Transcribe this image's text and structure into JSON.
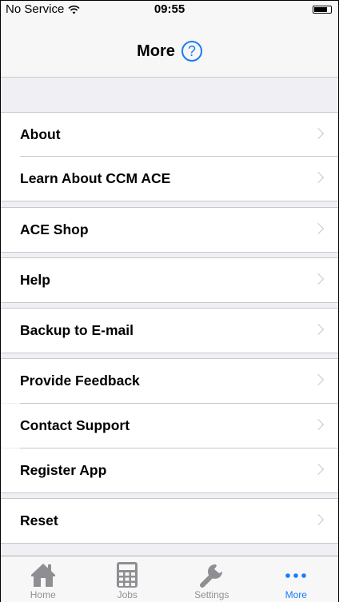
{
  "status_bar": {
    "carrier": "No Service",
    "time": "09:55",
    "battery_level": 0.8
  },
  "nav": {
    "title": "More",
    "help_symbol": "?"
  },
  "menu": {
    "about": "About",
    "learn": "Learn About CCM ACE",
    "shop": "ACE Shop",
    "help": "Help",
    "backup": "Backup to E-mail",
    "feedback": "Provide Feedback",
    "contact": "Contact Support",
    "register": "Register App",
    "reset": "Reset"
  },
  "tabs": {
    "home": "Home",
    "jobs": "Jobs",
    "settings": "Settings",
    "more": "More",
    "active": "more"
  },
  "colors": {
    "accent": "#1b7cf5",
    "inactive": "#929292",
    "group_background": "#efeff4",
    "separator": "#c8c7cc"
  },
  "icons": {
    "wifi": "wifi-icon",
    "battery": "battery-icon",
    "help": "help-icon",
    "chevron": "chevron-right-icon",
    "home": "home-icon",
    "jobs": "calculator-icon",
    "settings": "wrench-icon",
    "more": "more-dots-icon"
  }
}
